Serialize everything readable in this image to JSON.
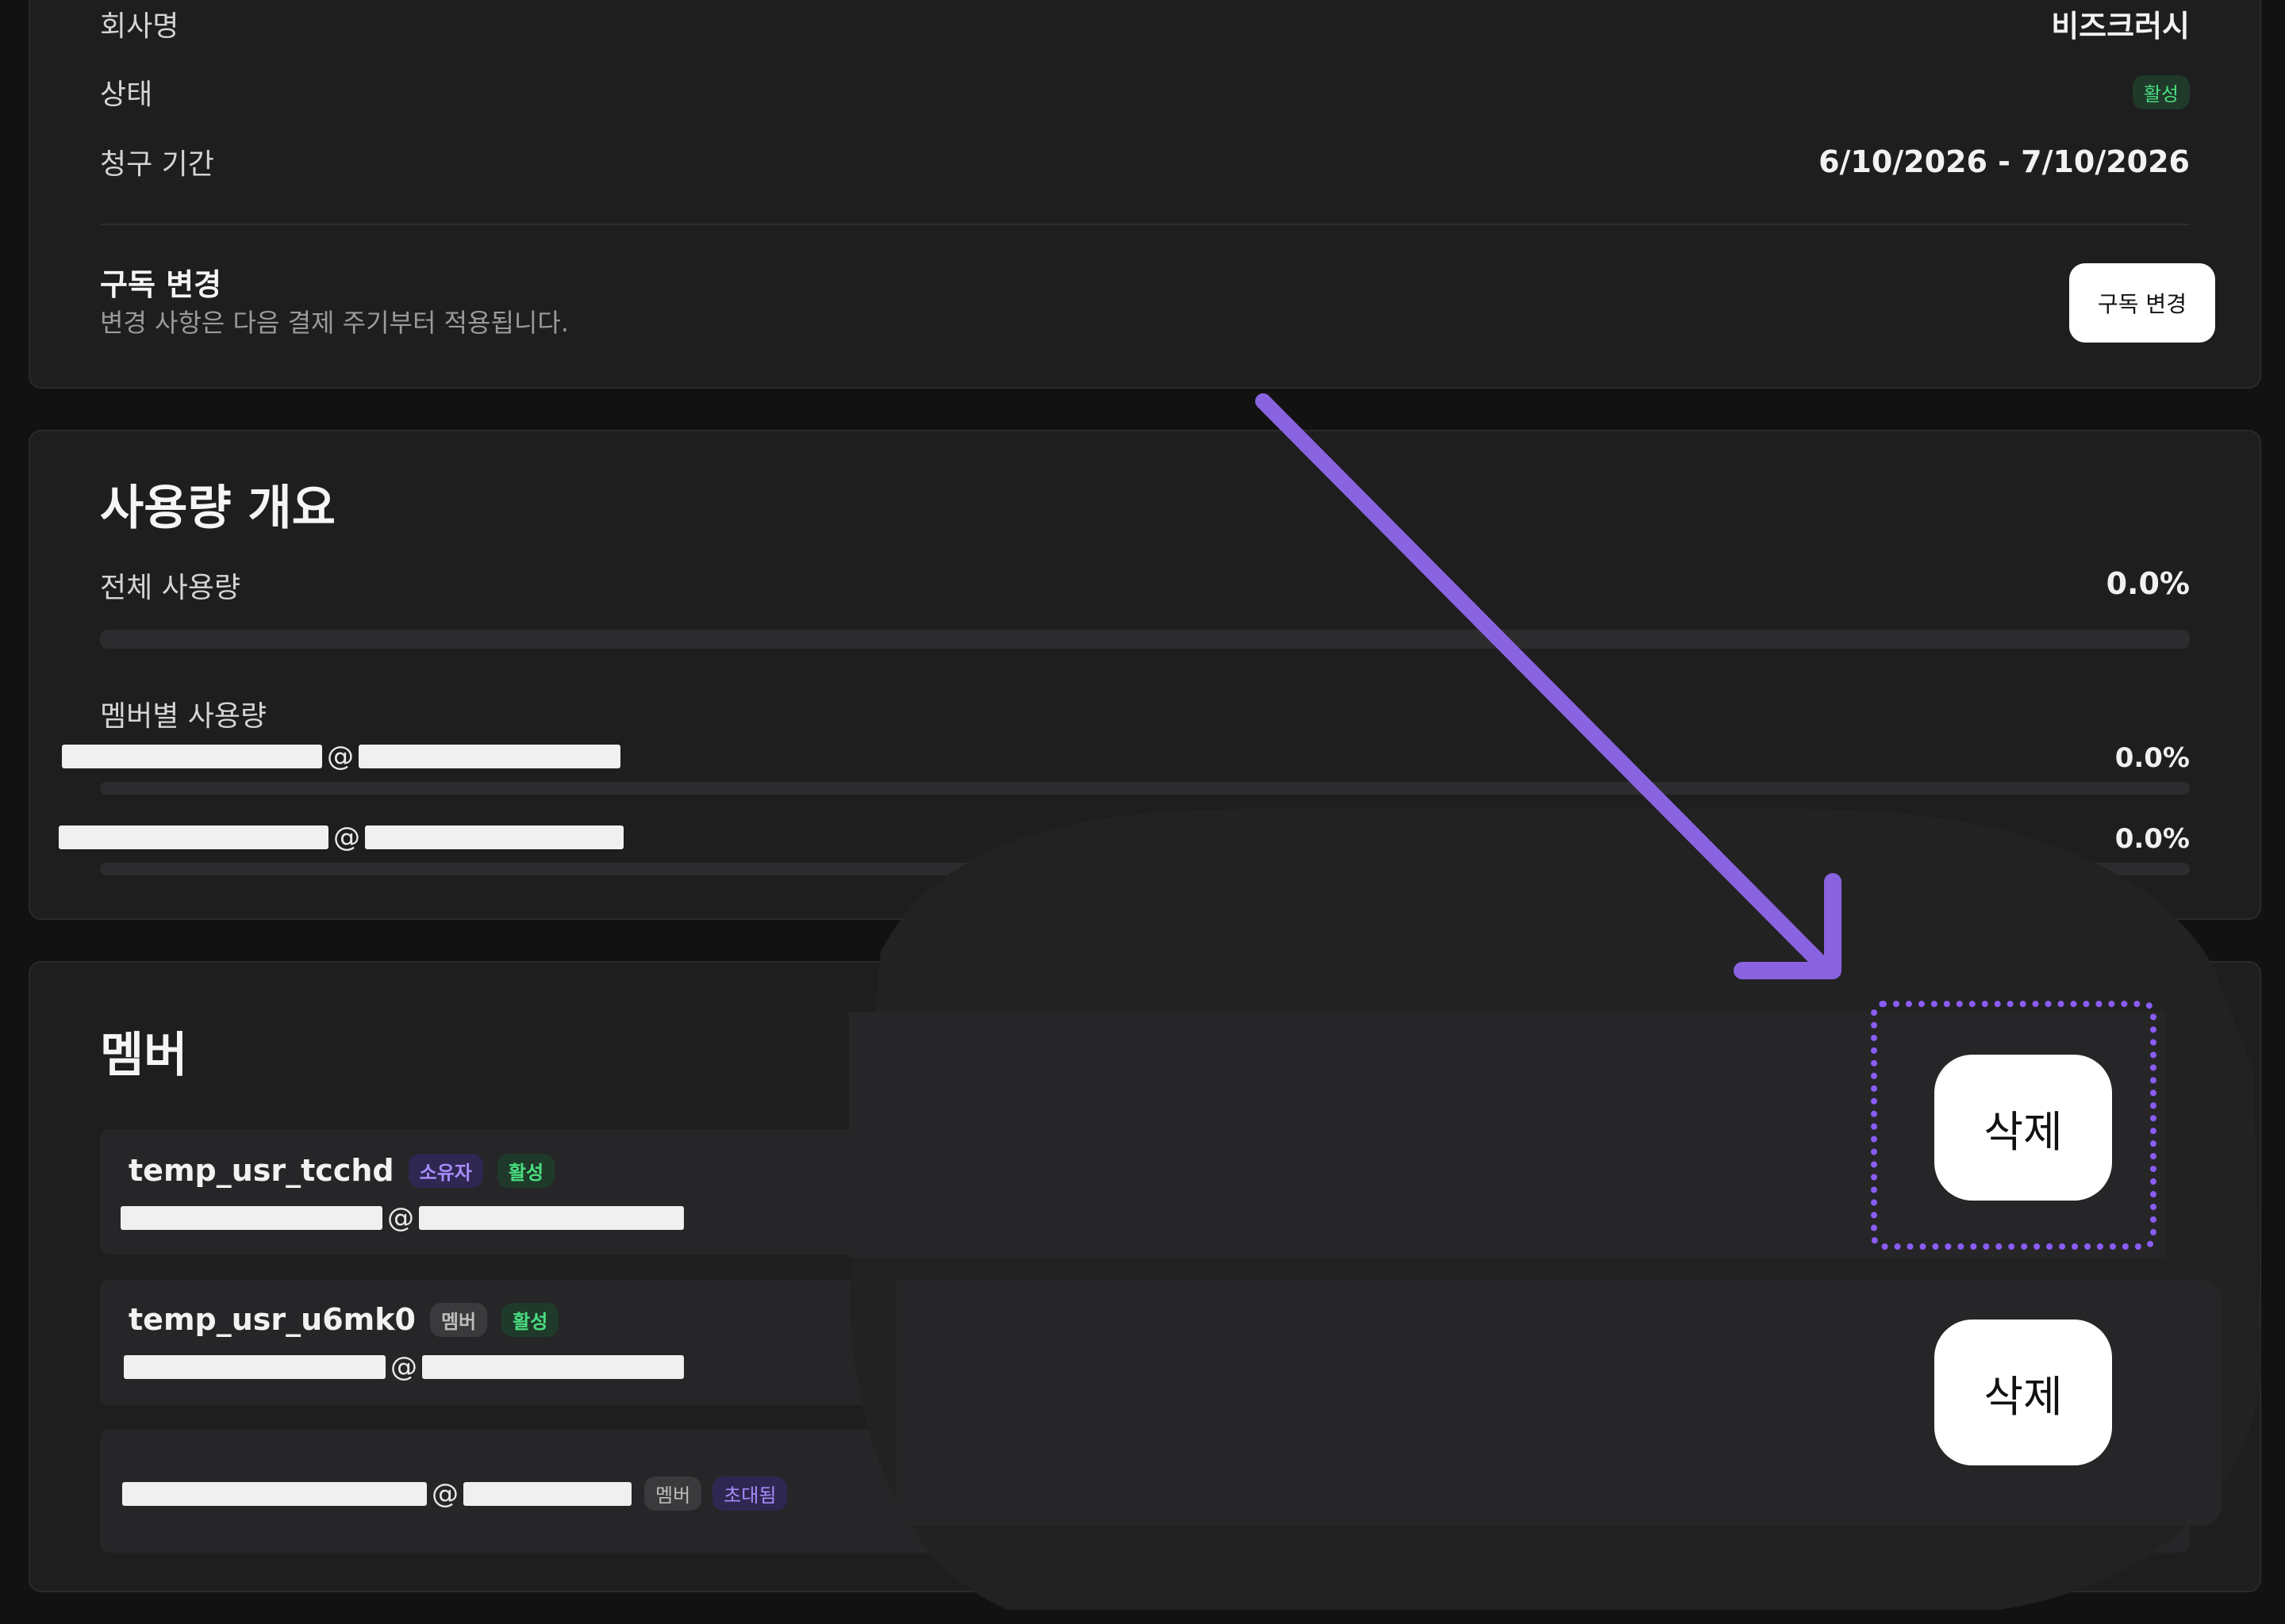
{
  "billing": {
    "company_label": "회사명",
    "company_value": "비즈크러시",
    "status_label": "상태",
    "status_badge": "활성",
    "period_label": "청구 기간",
    "period_value": "6/10/2026 - 7/10/2026",
    "change_title": "구독 변경",
    "change_desc": "변경 사항은 다음 결제 주기부터 적용됩니다.",
    "change_button": "구독 변경"
  },
  "usage": {
    "title": "사용량 개요",
    "total_label": "전체 사용량",
    "total_value": "0.0%",
    "total_progress": 0,
    "per_member_label": "멤버별 사용량",
    "members": [
      {
        "email_at": "@",
        "value": "0.0%",
        "progress": 0
      },
      {
        "email_at": "@",
        "value": "0.0%",
        "progress": 0
      }
    ]
  },
  "members": {
    "title": "멤버",
    "rows": [
      {
        "name": "temp_usr_tcchd",
        "role": "소유자",
        "status": "활성",
        "email_at": "@"
      },
      {
        "name": "temp_usr_u6mk0",
        "role": "멤버",
        "status": "활성",
        "email_at": "@"
      },
      {
        "name": "",
        "role": "멤버",
        "status": "초대됨",
        "email_at": "@"
      }
    ],
    "delete_label": "삭제"
  },
  "colors": {
    "accent": "#8b5cf6",
    "background": "#121212",
    "card": "#1e1e1f",
    "status_active": "#4ade80"
  }
}
